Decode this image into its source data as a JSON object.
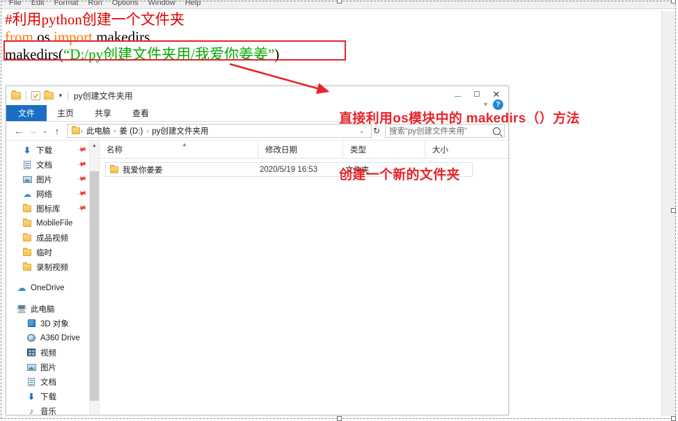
{
  "idle": {
    "menu": [
      {
        "label": "File",
        "accel": "F"
      },
      {
        "label": "Edit",
        "accel": "E"
      },
      {
        "label": "Format",
        "accel": "o"
      },
      {
        "label": "Run",
        "accel": "R"
      },
      {
        "label": "Options",
        "accel": "O"
      },
      {
        "label": "Window",
        "accel": "W"
      },
      {
        "label": "Help",
        "accel": "H"
      }
    ],
    "code": {
      "line1_comment": "#利用python创建一个文件夹",
      "line2_kw1": "from",
      "line2_mod": " os ",
      "line2_kw2": "import",
      "line2_name": " makedirs",
      "line3_call": "makedirs(",
      "line3_string": "“D:/py创建文件夹用/我爱你姜姜”",
      "line3_end": ")"
    }
  },
  "annotation": {
    "line1": "直接利用os模块中的 makedirs（）方法",
    "line2": "创建一个新的文件夹",
    "color": "#E8232A"
  },
  "explorer": {
    "title": "py创建文件夹用",
    "quick_access": [
      "folder-icon",
      "properties-icon",
      "new-folder-icon",
      "customize-dropdown-icon"
    ],
    "window_buttons": [
      "minimize",
      "maximize",
      "close"
    ],
    "help_button": "?",
    "tabs": [
      {
        "label": "文件",
        "active": true
      },
      {
        "label": "主页",
        "active": false
      },
      {
        "label": "共享",
        "active": false
      },
      {
        "label": "查看",
        "active": false
      }
    ],
    "address": {
      "back": "←",
      "forward": "→",
      "recent": "⌄",
      "up": "↑",
      "crumbs": [
        "此电脑",
        "姜 (D:)",
        "py创建文件夹用"
      ],
      "separator": "›",
      "dropdown": "⌄",
      "refresh": "↻"
    },
    "search": {
      "placeholder": "搜索“py创建文件夹用”"
    },
    "nav_groups": [
      {
        "items": [
          {
            "label": "下载",
            "icon": "download-icon",
            "pinned": true,
            "level": 1
          },
          {
            "label": "文档",
            "icon": "document-icon",
            "pinned": true,
            "level": 1
          },
          {
            "label": "图片",
            "icon": "pictures-icon",
            "pinned": true,
            "level": 1
          },
          {
            "label": "网络",
            "icon": "network-icon",
            "pinned": true,
            "level": 1
          },
          {
            "label": "图标库",
            "icon": "folder-icon",
            "pinned": true,
            "level": 1
          },
          {
            "label": "MobileFile",
            "icon": "folder-icon",
            "pinned": false,
            "level": 1
          },
          {
            "label": "成品视频",
            "icon": "folder-icon",
            "pinned": false,
            "level": 1
          },
          {
            "label": "临时",
            "icon": "folder-icon",
            "pinned": false,
            "level": 1
          },
          {
            "label": "录制视频",
            "icon": "folder-icon",
            "pinned": false,
            "level": 1
          }
        ]
      },
      {
        "items": [
          {
            "label": "OneDrive",
            "icon": "cloud-icon",
            "pinned": false,
            "level": 0
          }
        ]
      },
      {
        "items": [
          {
            "label": "此电脑",
            "icon": "this-pc-icon",
            "pinned": false,
            "level": 0
          },
          {
            "label": "3D 对象",
            "icon": "3d-objects-icon",
            "pinned": false,
            "level": 1
          },
          {
            "label": "A360 Drive",
            "icon": "a360-drive-icon",
            "pinned": false,
            "level": 1
          },
          {
            "label": "视频",
            "icon": "videos-icon",
            "pinned": false,
            "level": 1
          },
          {
            "label": "图片",
            "icon": "pictures-icon",
            "pinned": false,
            "level": 1
          },
          {
            "label": "文档",
            "icon": "document-icon",
            "pinned": false,
            "level": 1
          },
          {
            "label": "下载",
            "icon": "download-icon",
            "pinned": false,
            "level": 1
          },
          {
            "label": "音乐",
            "icon": "music-icon",
            "pinned": false,
            "level": 1
          }
        ]
      }
    ],
    "columns": [
      "名称",
      "修改日期",
      "类型",
      "大小"
    ],
    "rows": [
      {
        "name": "我爱你姜姜",
        "date": "2020/5/19 16:53",
        "type": "文件夹",
        "size": "",
        "icon": "folder-icon",
        "selected": true
      }
    ]
  }
}
